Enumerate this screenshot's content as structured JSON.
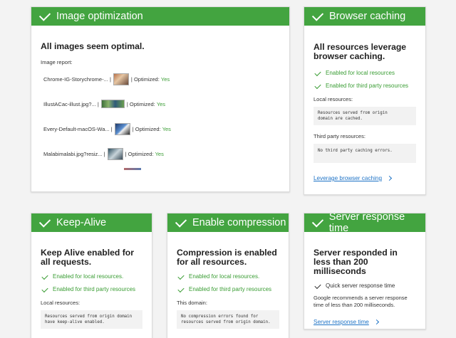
{
  "colors": {
    "accent": "#43a440",
    "link": "#1e73c6",
    "ok_text": "#3a9d34"
  },
  "image_opt": {
    "header": "Image optimization",
    "title": "All images seem optimal.",
    "report_label": "Image report:",
    "rows": [
      {
        "name": "Chrome-IG-Storychrome-...",
        "sep1": "|",
        "sep2": "| Optimized:",
        "status": "Yes"
      },
      {
        "name": "IllustACac-illust.jpg?...",
        "sep1": "|",
        "sep2": "| Optimized:",
        "status": "Yes"
      },
      {
        "name": "Every-Default-macOS-Wa...",
        "sep1": "|",
        "sep2": "| Optimized:",
        "status": "Yes"
      },
      {
        "name": "Malabimalabi.jpg?resiz...",
        "sep1": "|",
        "sep2": "| Optimized:",
        "status": "Yes"
      }
    ]
  },
  "browser_cache": {
    "header": "Browser caching",
    "title": "All resources leverage browser caching.",
    "ok1": "Enabled for local resources",
    "ok2": "Enabled for third party resources",
    "local_label": "Local resources:",
    "local_code": "Resources served from origin domain are cached.",
    "third_label": "Third party resources:",
    "third_code": "No third party caching errors.",
    "link": "Leverage browser caching"
  },
  "keep_alive": {
    "header": "Keep-Alive",
    "title": "Keep Alive enabled for all requests.",
    "ok1": "Enabled for local resources.",
    "ok2": "Enabled for third party resources",
    "local_label": "Local resources:",
    "local_code": "Resources served from origin domain have keep-alive enabled."
  },
  "compression": {
    "header": "Enable compression",
    "title": "Compression is enabled for all resources.",
    "ok1": "Enabled for local resources.",
    "ok2": "Enabled for third party resources",
    "domain_label": "This domain:",
    "domain_code": "No compression errors found for resources served from origin domain."
  },
  "server": {
    "header": "Server response time",
    "title": "Server responded in less than 200 milliseconds",
    "ok1": "Quick server response time",
    "desc": "Google recommends a server response time of less than 200 milliseconds.",
    "link": "Server response time"
  }
}
